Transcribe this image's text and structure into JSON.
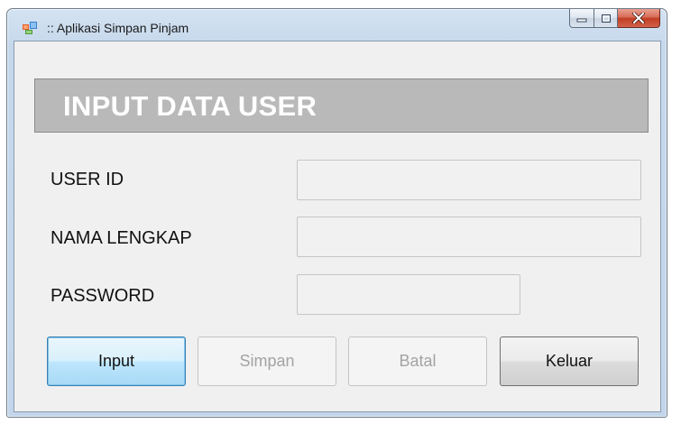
{
  "window": {
    "title": ":: Aplikasi Simpan Pinjam",
    "icon": "winforms-app-icon",
    "controls": [
      "minimize-icon",
      "maximize-icon",
      "close-icon"
    ]
  },
  "header": {
    "title": "INPUT DATA USER"
  },
  "form": {
    "user_id_label": "USER ID",
    "user_id_value": "",
    "nama_lengkap_label": "NAMA LENGKAP",
    "nama_lengkap_value": "",
    "password_label": "PASSWORD",
    "password_value": ""
  },
  "buttons": {
    "input_label": "Input",
    "simpan_label": "Simpan",
    "batal_label": "Batal",
    "keluar_label": "Keluar"
  },
  "colors": {
    "header_bg": "#b9b9b9",
    "header_text": "#ffffff",
    "form_bg": "#f0f0f0",
    "focus_border": "#3c7fb1",
    "disabled_text": "#a3a3a3"
  }
}
